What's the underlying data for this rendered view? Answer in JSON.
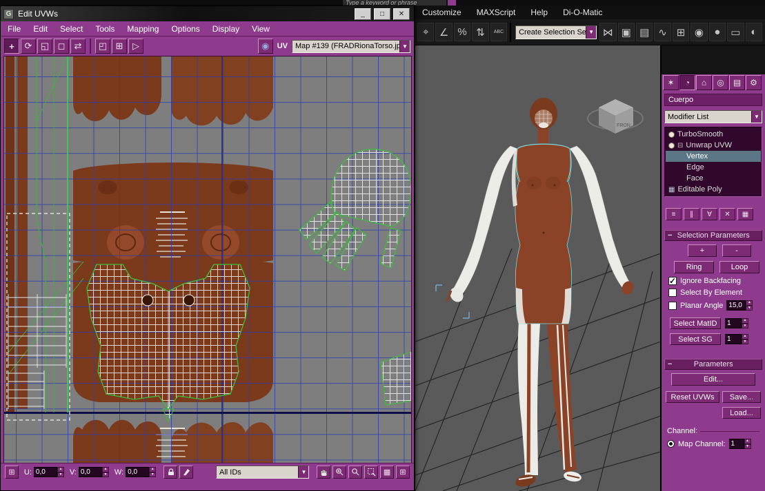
{
  "colors": {
    "panel_magenta": "#8e3b8e",
    "panel_dark": "#671f60",
    "button": "#7c2b74",
    "grid_blue": "#2b3db0",
    "texture_brown": "#7c3a1d",
    "mesh_green": "#3bbf3b",
    "canvas_gray": "#7e7e7e",
    "viewport_gray": "#5a5a5a",
    "stack_selected_highlight": "#5b7684"
  },
  "top": {
    "search_text": "Type a keyword or phrase"
  },
  "uvw": {
    "title": "Edit UVWs",
    "window_buttons": {
      "minimize": "_",
      "maximize": "□",
      "close": "✕"
    },
    "menu": [
      "File",
      "Edit",
      "Select",
      "Tools",
      "Mapping",
      "Options",
      "Display",
      "View"
    ],
    "toolbar": {
      "uv_label": "UV",
      "map_dropdown": "Map #139 (FRADRionaTorso.jp"
    },
    "status": {
      "u_label": "U:",
      "u_value": "0,0",
      "v_label": "V:",
      "v_value": "0,0",
      "w_label": "W:",
      "w_value": "0,0",
      "ids_dropdown": "All IDs"
    }
  },
  "main": {
    "menu": [
      "Customize",
      "MAXScript",
      "Help",
      "Di-O-Matic"
    ],
    "selection_set": "Create Selection Se",
    "viewcube": "FRON"
  },
  "panel": {
    "object_name": "Cuerpo",
    "modifier_list": "Modifier List",
    "stack": [
      {
        "label": "TurboSmooth"
      },
      {
        "label": "Unwrap UVW"
      },
      {
        "label": "Vertex",
        "selected": true
      },
      {
        "label": "Edge"
      },
      {
        "label": "Face"
      },
      {
        "label": "Editable Poly"
      }
    ],
    "sel_params": {
      "title": "Selection Parameters",
      "plus": "+",
      "minus": "-",
      "ring": "Ring",
      "loop": "Loop",
      "cb": [
        {
          "label": "Ignore Backfacing",
          "checked": true
        },
        {
          "label": "Select By Element",
          "checked": false
        },
        {
          "label": "Planar Angle",
          "checked": false
        }
      ],
      "planar_value": "15,0",
      "matid": "Select MatID",
      "matid_value": "1",
      "sg": "Select SG",
      "sg_value": "1"
    },
    "params": {
      "title": "Parameters",
      "edit": "Edit...",
      "reset": "Reset UVWs",
      "save": "Save...",
      "load": "Load...",
      "channel": "Channel:",
      "map_channel": "Map Channel:",
      "map_channel_value": "1",
      "map_channel_selected": true
    }
  },
  "icons": {
    "down": "▼",
    "up": "▲",
    "move": "+",
    "rotate": "⟳",
    "scale": "◱",
    "freeform": "◻",
    "mirror_sel": "⇄",
    "sub1": "◰",
    "sub2": "⊞",
    "sub3": "▷",
    "texture_sphere": "◉",
    "grid": "⊞",
    "grid2": "▦",
    "snap": "⌖",
    "angle": "∠",
    "percent": "%",
    "spinner_snap": "⇅",
    "kbd": "ABC",
    "mirror": "⋈",
    "align": "▣",
    "layers": "▤",
    "curves": "∿",
    "schematic": "⊞",
    "material": "◉",
    "render_setup": "●",
    "render_frame": "▭",
    "render": "◐",
    "tabs": [
      "✶",
      "◔",
      "⌂",
      "◎",
      "▤",
      "⚙"
    ],
    "expander": "⊟",
    "editable_poly": "▦",
    "stack_tools": [
      "≡",
      "∥",
      "∀",
      "✕",
      "▦"
    ]
  }
}
